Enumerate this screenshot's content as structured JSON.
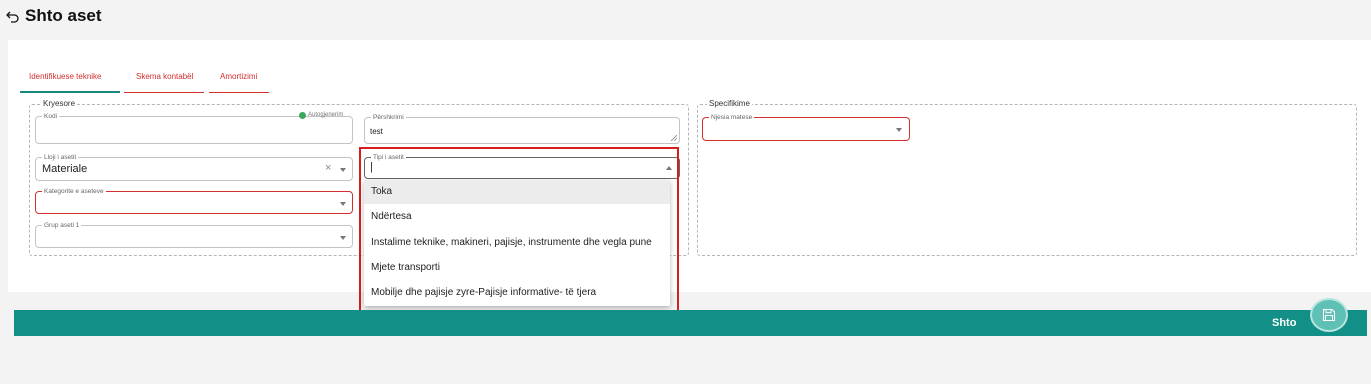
{
  "header": {
    "title": "Shto aset",
    "back_icon": "undo-arrow-icon"
  },
  "tabs": [
    {
      "label": "Identifikuese teknike",
      "active": true
    },
    {
      "label": "Skema kontabël",
      "active": false
    },
    {
      "label": "Amortizimi",
      "active": false
    }
  ],
  "kryesore": {
    "legend": "Kryesore",
    "kodi": {
      "label": "Kodi",
      "value": "",
      "auto_label": "Autogjenerim"
    },
    "pershkrimi": {
      "label": "Përshkrimi",
      "value": "test"
    },
    "lloji": {
      "label": "Lloji i asetit",
      "value": "Materiale",
      "clear_icon": "×"
    },
    "tipi": {
      "label": "Tipi i asetit",
      "value": "|"
    },
    "kategorite": {
      "label": "Kategorite e aseteve",
      "value": ""
    },
    "grup": {
      "label": "Grup aseti 1",
      "value": ""
    }
  },
  "specifikime": {
    "legend": "Specifikime",
    "njesia": {
      "label": "Njesia matese",
      "value": ""
    }
  },
  "dropdown": {
    "options": [
      "Toka",
      "Ndërtesa",
      "Instalime teknike, makineri, pajisje, instrumente dhe vegla pune",
      "Mjete transporti",
      "Mobilje dhe pajisje zyre-Pajisje informative- të tjera"
    ],
    "highlighted_index": 0
  },
  "action_bar": {
    "label": "Shto",
    "save_icon": "floppy-disk-icon"
  },
  "colors": {
    "accent": "#128f87",
    "error": "#d32f2f",
    "highlight": "#d71e1e"
  }
}
